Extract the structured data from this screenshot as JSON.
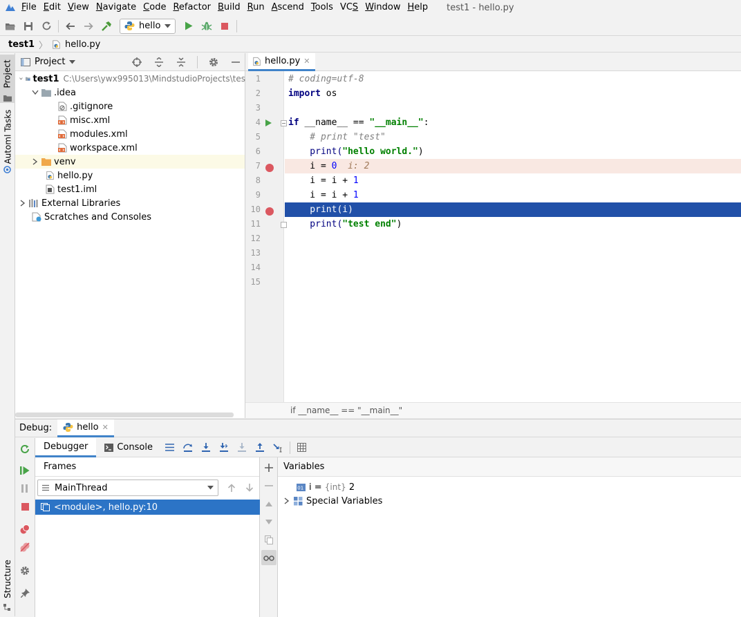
{
  "menu": {
    "items": [
      "File",
      "Edit",
      "View",
      "Navigate",
      "Code",
      "Refactor",
      "Build",
      "Run",
      "Ascend",
      "Tools",
      "VCS",
      "Window",
      "Help"
    ],
    "mnemonics": [
      "F",
      "E",
      "V",
      "N",
      "C",
      "R",
      "B",
      "R",
      "A",
      "T",
      "S",
      "W",
      "H"
    ],
    "window_title": "test1 - hello.py"
  },
  "toolbar": {
    "run_config": "hello"
  },
  "breadcrumb": {
    "project": "test1",
    "file": "hello.py"
  },
  "side_tabs": {
    "project": "Project",
    "automl": "Automl Tasks",
    "structure": "Structure"
  },
  "project_panel": {
    "title": "Project",
    "tree": [
      {
        "label": "test1",
        "path": "C:\\Users\\ywx995013\\MindstudioProjects\\tes",
        "bold": true
      },
      {
        "label": ".idea"
      },
      {
        "label": ".gitignore"
      },
      {
        "label": "misc.xml"
      },
      {
        "label": "modules.xml"
      },
      {
        "label": "workspace.xml"
      },
      {
        "label": "venv"
      },
      {
        "label": "hello.py"
      },
      {
        "label": "test1.iml"
      },
      {
        "label": "External Libraries"
      },
      {
        "label": "Scratches and Consoles"
      }
    ]
  },
  "editor": {
    "tab": "hello.py",
    "line_numbers": [
      "1",
      "2",
      "3",
      "4",
      "5",
      "6",
      "7",
      "8",
      "9",
      "10",
      "11",
      "12",
      "13",
      "14",
      "15"
    ],
    "lines": {
      "l1": "# coding=utf-8",
      "l2_kw": "import",
      "l2_rest": " os",
      "l4_kw": "if",
      "l4_mid": " __name__ == ",
      "l4_str": "\"__main__\"",
      "l4_end": ":",
      "l5": "    # print \"test\"",
      "l6_fn": "    print(",
      "l6_str": "\"hello world.\"",
      "l6_end": ")",
      "l7_code": "    i = ",
      "l7_num": "0",
      "l7_inline": "  i: 2",
      "l8_code": "    i = i + ",
      "l8_num": "1",
      "l9_code": "    i = i + ",
      "l9_num": "1",
      "l10": "    print(i)",
      "l11_fn": "    print(",
      "l11_str": "\"test end\"",
      "l11_end": ")"
    },
    "status": "if __name__ == \"__main__\""
  },
  "debug": {
    "label": "Debug:",
    "session": "hello",
    "tabs": {
      "debugger": "Debugger",
      "console": "Console"
    },
    "frames_title": "Frames",
    "thread": "MainThread",
    "frame": "<module>, hello.py:10",
    "variables_title": "Variables",
    "variables": [
      {
        "name": "i",
        "eq": " = ",
        "type": "{int}",
        "value": " 2"
      },
      {
        "name": "Special Variables"
      }
    ]
  },
  "colors": {
    "accent": "#2c74c6",
    "breakpoint": "#db5860",
    "selected_line": "#2150a8",
    "exec_line_bg": "#f9e8e2"
  }
}
